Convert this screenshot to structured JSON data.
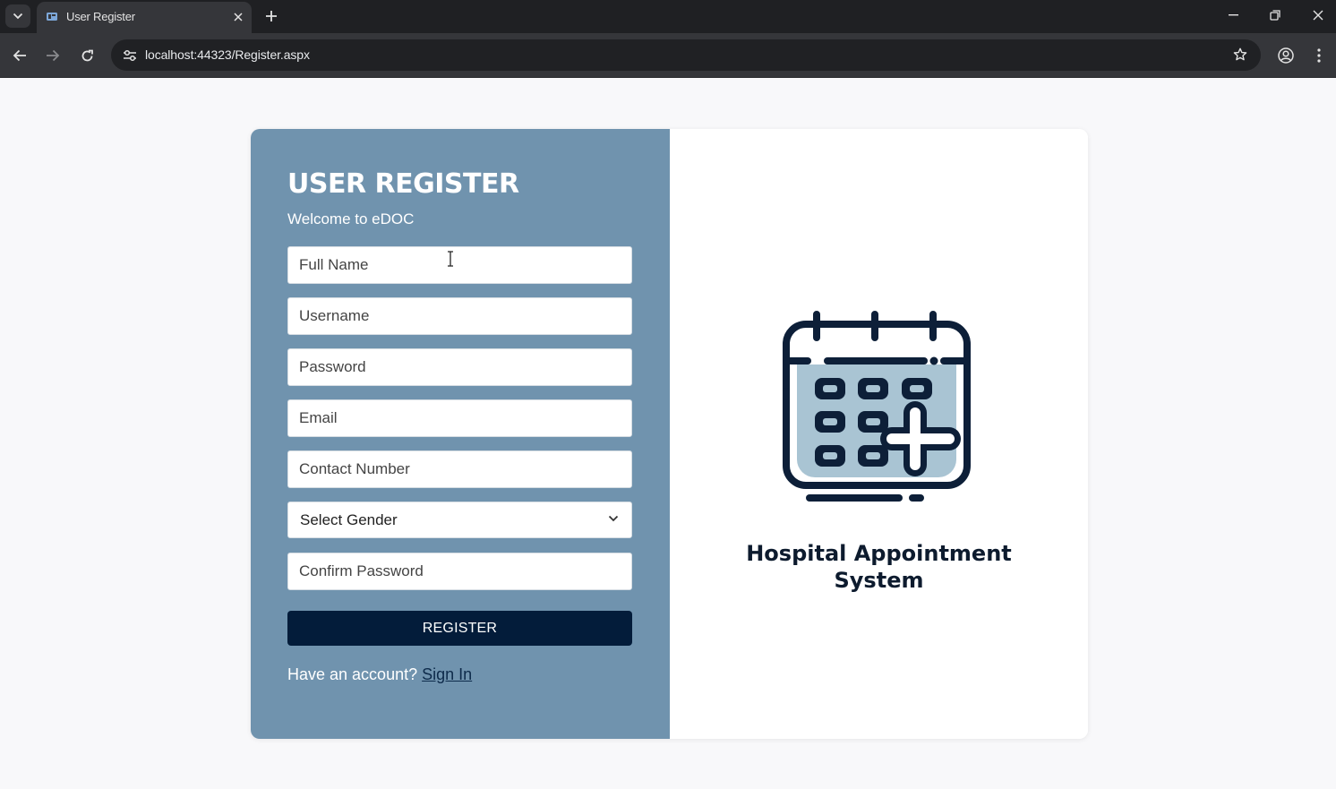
{
  "browser": {
    "tab_title": "User Register",
    "url": "localhost:44323/Register.aspx"
  },
  "form": {
    "heading": "USER REGISTER",
    "welcome": "Welcome to eDOC",
    "fields": {
      "full_name": "Full Name",
      "username": "Username",
      "password": "Password",
      "email": "Email",
      "contact": "Contact Number",
      "confirm_password": "Confirm Password"
    },
    "gender_select": "Select Gender",
    "register_label": "REGISTER",
    "signin_prompt": "Have an account?",
    "signin_link": "Sign In"
  },
  "brand": {
    "app_name_line1": "Hospital Appointment",
    "app_name_line2": "System"
  },
  "colors": {
    "panel": "#7093ae",
    "button": "#031c3a",
    "calendar_fill": "#a9c4d3",
    "calendar_stroke": "#0d1f38"
  },
  "icons": [
    "tab-search-icon",
    "favicon-icon",
    "close-icon",
    "plus-icon",
    "minimize-icon",
    "restore-icon",
    "back-icon",
    "forward-icon",
    "reload-icon",
    "site-info-icon",
    "star-icon",
    "profile-icon",
    "menu-icon",
    "chevron-down-icon",
    "calendar-plus-icon"
  ]
}
